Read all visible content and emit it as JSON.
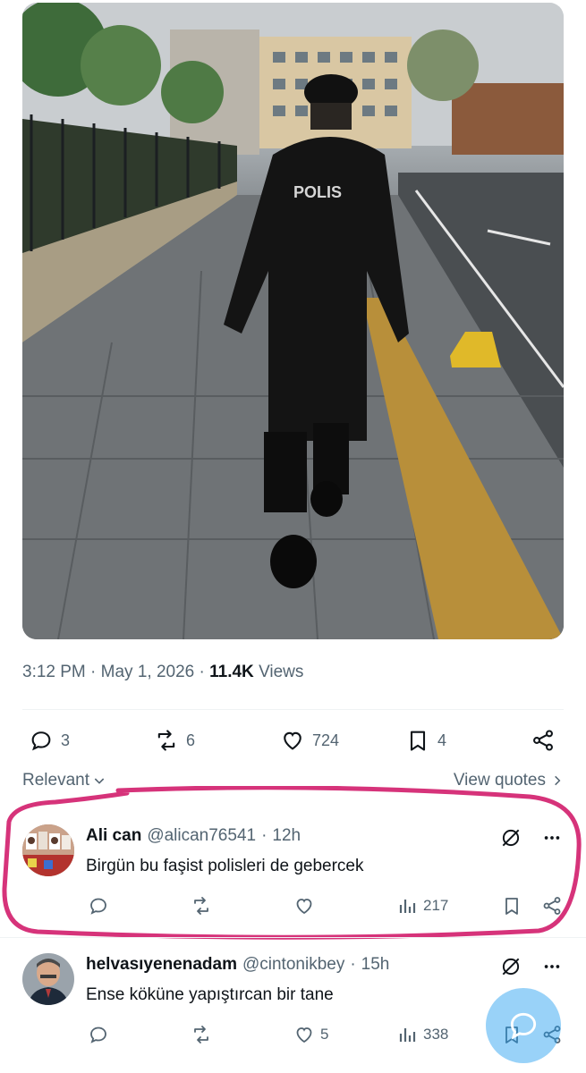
{
  "tweet": {
    "time": "3:12 PM",
    "date": "May 1, 2026",
    "views_count": "11.4K",
    "views_label": "Views",
    "image_text": "POLIS",
    "metrics": {
      "replies": "3",
      "reposts": "6",
      "likes": "724",
      "bookmarks": "4"
    }
  },
  "sort": {
    "label": "Relevant",
    "view_quotes": "View quotes"
  },
  "replies": [
    {
      "name": "Ali can",
      "handle": "@alican76541",
      "time": "12h",
      "text": "Birgün bu faşist polisleri de gebercek",
      "likes": "",
      "views": "217"
    },
    {
      "name": "helvasıyenenadam",
      "handle": "@cintonikbey",
      "time": "15h",
      "text": "Ense köküne yapıştırcan bir tane",
      "likes": "5",
      "views": "338"
    }
  ],
  "colors": {
    "highlight": "#d6337a",
    "fab": "#1d9bf0",
    "muted": "#536471"
  },
  "icons": [
    "reply-icon",
    "repost-icon",
    "like-icon",
    "bookmark-icon",
    "share-icon",
    "views-icon",
    "grok-icon",
    "more-icon",
    "compose-icon"
  ]
}
